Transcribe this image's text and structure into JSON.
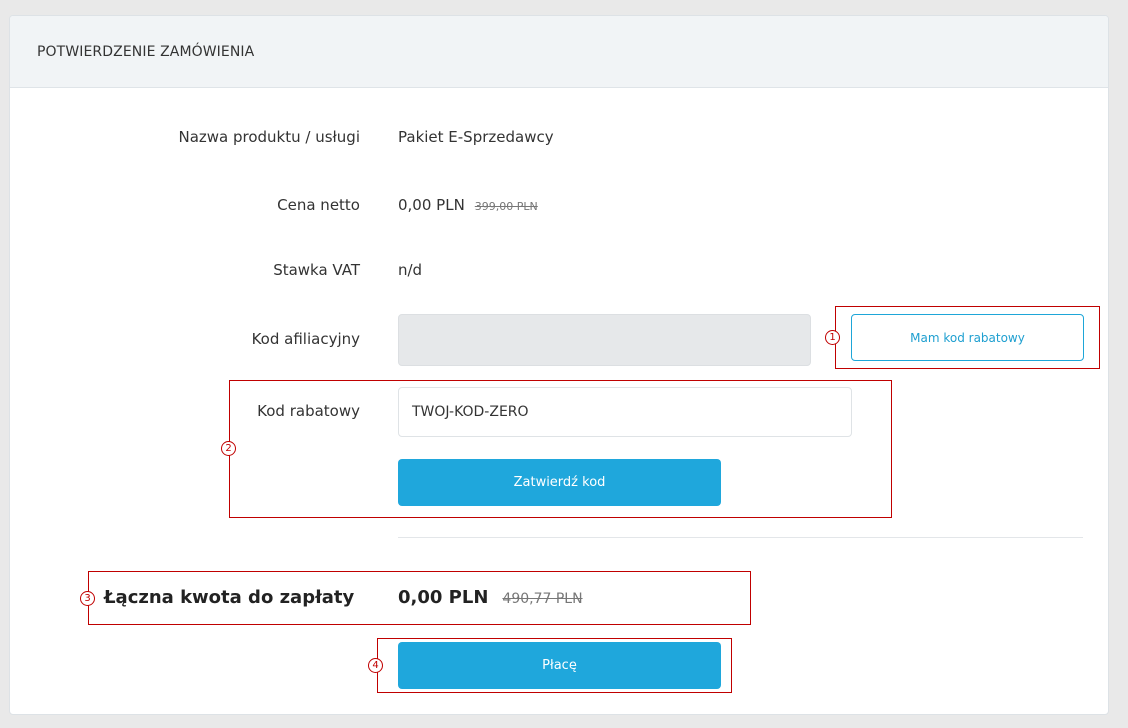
{
  "header": {
    "title": "POTWIERDZENIE ZAMÓWIENIA"
  },
  "rows": {
    "product": {
      "label": "Nazwa produktu / usługi",
      "value": "Pakiet E-Sprzedawcy"
    },
    "net_price": {
      "label": "Cena netto",
      "value": "0,00 PLN",
      "old_value": "399,00 PLN"
    },
    "vat": {
      "label": "Stawka VAT",
      "value": "n/d"
    },
    "affiliate": {
      "label": "Kod afiliacyjny",
      "value": ""
    },
    "discount": {
      "label": "Kod rabatowy",
      "value": "TWOJ-KOD-ZERO"
    }
  },
  "buttons": {
    "have_code": "Mam kod rabatowy",
    "confirm_code": "Zatwierdź kod",
    "pay": "Płacę"
  },
  "total": {
    "label": "Łączna kwota do zapłaty",
    "value": "0,00 PLN",
    "old_value": "490,77 PLN"
  },
  "annotations": {
    "marker1": "1",
    "marker2": "2",
    "marker3": "3",
    "marker4": "4",
    "color": "#c00000"
  },
  "colors": {
    "accent": "#1fa7dc",
    "header_bg": "#f1f4f6",
    "page_bg": "#e9e9e9"
  }
}
